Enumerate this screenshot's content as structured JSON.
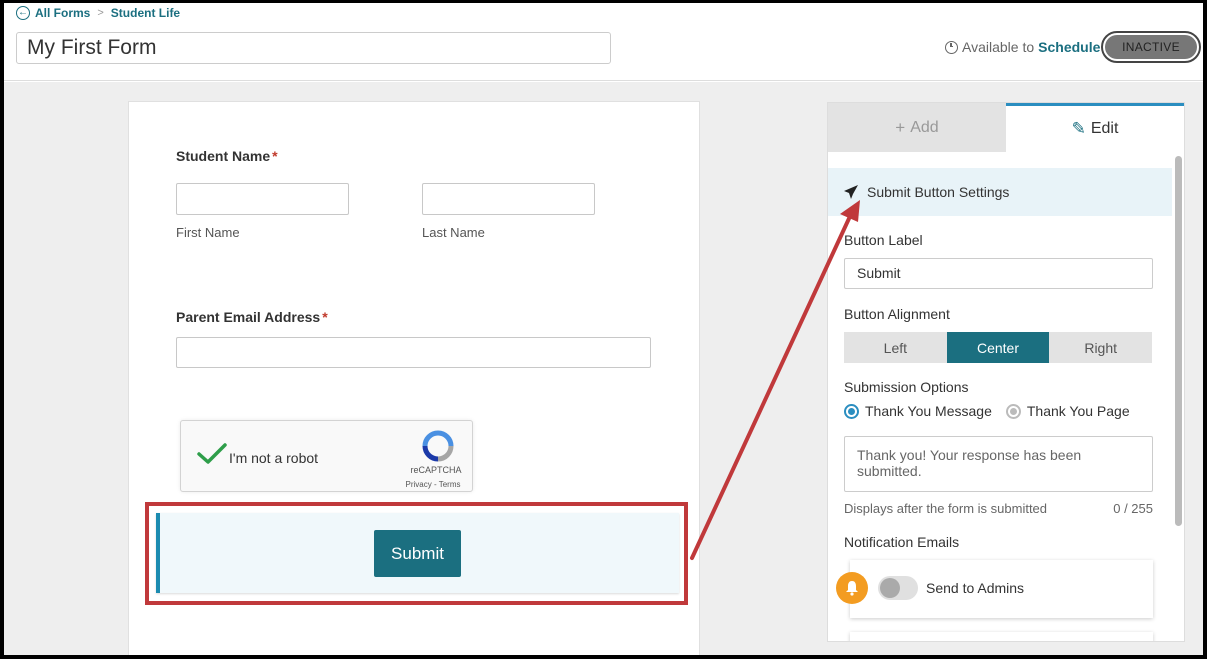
{
  "breadcrumb": {
    "root": "All Forms",
    "separator": ">",
    "current": "Student Life"
  },
  "form_title": "My First Form",
  "availability": {
    "prefix": "Available to",
    "link": "Schedule",
    "status": "INACTIVE"
  },
  "form": {
    "student_name": {
      "label": "Student Name",
      "required_mark": "*",
      "first_label": "First Name",
      "last_label": "Last Name"
    },
    "parent_email": {
      "label": "Parent Email Address",
      "required_mark": "*"
    },
    "captcha": {
      "text": "I'm not a robot",
      "brand": "reCAPTCHA",
      "terms": "Privacy - Terms"
    },
    "submit_label": "Submit"
  },
  "panel": {
    "tabs": {
      "add": "Add",
      "edit": "Edit"
    },
    "active_tab": "Edit",
    "section_title": "Submit Button Settings",
    "button_label": {
      "label": "Button Label",
      "value": "Submit"
    },
    "alignment": {
      "label": "Button Alignment",
      "options": [
        "Left",
        "Center",
        "Right"
      ],
      "selected": "Center"
    },
    "submission": {
      "label": "Submission Options",
      "options": [
        "Thank You Message",
        "Thank You Page"
      ],
      "selected": "Thank You Message",
      "message": "Thank you! Your response has been submitted.",
      "hint": "Displays after the form is submitted",
      "counter": "0 / 255"
    },
    "notifications": {
      "label": "Notification Emails",
      "send_to_admins": "Send to Admins",
      "send_to_admins_on": false
    }
  },
  "colors": {
    "accent": "#1b6f80",
    "highlight": "#c0393b",
    "bell": "#f39c21"
  }
}
